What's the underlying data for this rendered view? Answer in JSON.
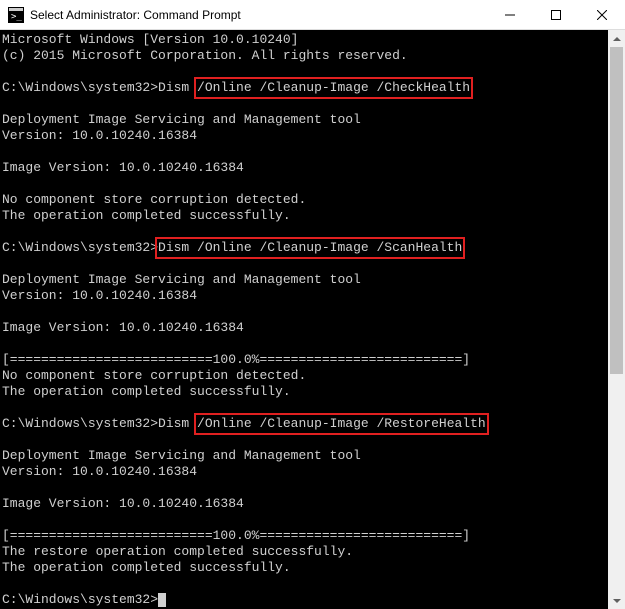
{
  "window": {
    "title": "Select Administrator: Command Prompt"
  },
  "t": {
    "l1": "Microsoft Windows [Version 10.0.10240]",
    "l2": "(c) 2015 Microsoft Corporation. All rights reserved.",
    "p1a": "C:\\Windows\\system32>Dism ",
    "p1b": "/Online /Cleanup-Image /CheckHealth",
    "tool": "Deployment Image Servicing and Management tool",
    "ver": "Version: 10.0.10240.16384",
    "imgver": "Image Version: 10.0.10240.16384",
    "noc": "No component store corruption detected.",
    "ok": "The operation completed successfully.",
    "p2a": "C:\\Windows\\system32>",
    "p2b": "Dism /Online /Cleanup-Image /ScanHealth",
    "prog": "[==========================100.0%==========================]",
    "p3a": "C:\\Windows\\system32>Dism ",
    "p3b": "/Online /Cleanup-Image /RestoreHealth",
    "rok": "The restore operation completed successfully.",
    "p4": "C:\\Windows\\system32>"
  }
}
